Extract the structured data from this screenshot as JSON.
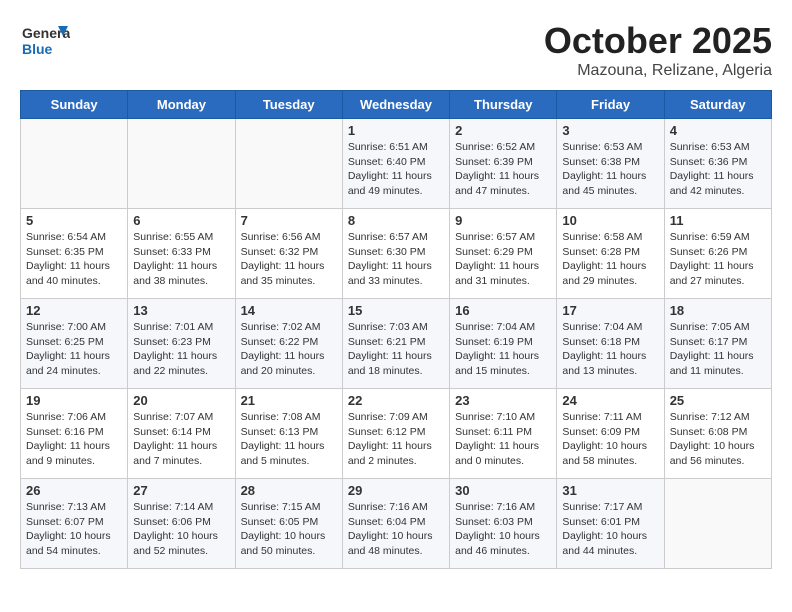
{
  "header": {
    "logo_line1": "General",
    "logo_line2": "Blue",
    "month": "October 2025",
    "location": "Mazouna, Relizane, Algeria"
  },
  "weekdays": [
    "Sunday",
    "Monday",
    "Tuesday",
    "Wednesday",
    "Thursday",
    "Friday",
    "Saturday"
  ],
  "weeks": [
    [
      {
        "day": "",
        "info": ""
      },
      {
        "day": "",
        "info": ""
      },
      {
        "day": "",
        "info": ""
      },
      {
        "day": "1",
        "info": "Sunrise: 6:51 AM\nSunset: 6:40 PM\nDaylight: 11 hours\nand 49 minutes."
      },
      {
        "day": "2",
        "info": "Sunrise: 6:52 AM\nSunset: 6:39 PM\nDaylight: 11 hours\nand 47 minutes."
      },
      {
        "day": "3",
        "info": "Sunrise: 6:53 AM\nSunset: 6:38 PM\nDaylight: 11 hours\nand 45 minutes."
      },
      {
        "day": "4",
        "info": "Sunrise: 6:53 AM\nSunset: 6:36 PM\nDaylight: 11 hours\nand 42 minutes."
      }
    ],
    [
      {
        "day": "5",
        "info": "Sunrise: 6:54 AM\nSunset: 6:35 PM\nDaylight: 11 hours\nand 40 minutes."
      },
      {
        "day": "6",
        "info": "Sunrise: 6:55 AM\nSunset: 6:33 PM\nDaylight: 11 hours\nand 38 minutes."
      },
      {
        "day": "7",
        "info": "Sunrise: 6:56 AM\nSunset: 6:32 PM\nDaylight: 11 hours\nand 35 minutes."
      },
      {
        "day": "8",
        "info": "Sunrise: 6:57 AM\nSunset: 6:30 PM\nDaylight: 11 hours\nand 33 minutes."
      },
      {
        "day": "9",
        "info": "Sunrise: 6:57 AM\nSunset: 6:29 PM\nDaylight: 11 hours\nand 31 minutes."
      },
      {
        "day": "10",
        "info": "Sunrise: 6:58 AM\nSunset: 6:28 PM\nDaylight: 11 hours\nand 29 minutes."
      },
      {
        "day": "11",
        "info": "Sunrise: 6:59 AM\nSunset: 6:26 PM\nDaylight: 11 hours\nand 27 minutes."
      }
    ],
    [
      {
        "day": "12",
        "info": "Sunrise: 7:00 AM\nSunset: 6:25 PM\nDaylight: 11 hours\nand 24 minutes."
      },
      {
        "day": "13",
        "info": "Sunrise: 7:01 AM\nSunset: 6:23 PM\nDaylight: 11 hours\nand 22 minutes."
      },
      {
        "day": "14",
        "info": "Sunrise: 7:02 AM\nSunset: 6:22 PM\nDaylight: 11 hours\nand 20 minutes."
      },
      {
        "day": "15",
        "info": "Sunrise: 7:03 AM\nSunset: 6:21 PM\nDaylight: 11 hours\nand 18 minutes."
      },
      {
        "day": "16",
        "info": "Sunrise: 7:04 AM\nSunset: 6:19 PM\nDaylight: 11 hours\nand 15 minutes."
      },
      {
        "day": "17",
        "info": "Sunrise: 7:04 AM\nSunset: 6:18 PM\nDaylight: 11 hours\nand 13 minutes."
      },
      {
        "day": "18",
        "info": "Sunrise: 7:05 AM\nSunset: 6:17 PM\nDaylight: 11 hours\nand 11 minutes."
      }
    ],
    [
      {
        "day": "19",
        "info": "Sunrise: 7:06 AM\nSunset: 6:16 PM\nDaylight: 11 hours\nand 9 minutes."
      },
      {
        "day": "20",
        "info": "Sunrise: 7:07 AM\nSunset: 6:14 PM\nDaylight: 11 hours\nand 7 minutes."
      },
      {
        "day": "21",
        "info": "Sunrise: 7:08 AM\nSunset: 6:13 PM\nDaylight: 11 hours\nand 5 minutes."
      },
      {
        "day": "22",
        "info": "Sunrise: 7:09 AM\nSunset: 6:12 PM\nDaylight: 11 hours\nand 2 minutes."
      },
      {
        "day": "23",
        "info": "Sunrise: 7:10 AM\nSunset: 6:11 PM\nDaylight: 11 hours\nand 0 minutes."
      },
      {
        "day": "24",
        "info": "Sunrise: 7:11 AM\nSunset: 6:09 PM\nDaylight: 10 hours\nand 58 minutes."
      },
      {
        "day": "25",
        "info": "Sunrise: 7:12 AM\nSunset: 6:08 PM\nDaylight: 10 hours\nand 56 minutes."
      }
    ],
    [
      {
        "day": "26",
        "info": "Sunrise: 7:13 AM\nSunset: 6:07 PM\nDaylight: 10 hours\nand 54 minutes."
      },
      {
        "day": "27",
        "info": "Sunrise: 7:14 AM\nSunset: 6:06 PM\nDaylight: 10 hours\nand 52 minutes."
      },
      {
        "day": "28",
        "info": "Sunrise: 7:15 AM\nSunset: 6:05 PM\nDaylight: 10 hours\nand 50 minutes."
      },
      {
        "day": "29",
        "info": "Sunrise: 7:16 AM\nSunset: 6:04 PM\nDaylight: 10 hours\nand 48 minutes."
      },
      {
        "day": "30",
        "info": "Sunrise: 7:16 AM\nSunset: 6:03 PM\nDaylight: 10 hours\nand 46 minutes."
      },
      {
        "day": "31",
        "info": "Sunrise: 7:17 AM\nSunset: 6:01 PM\nDaylight: 10 hours\nand 44 minutes."
      },
      {
        "day": "",
        "info": ""
      }
    ]
  ]
}
